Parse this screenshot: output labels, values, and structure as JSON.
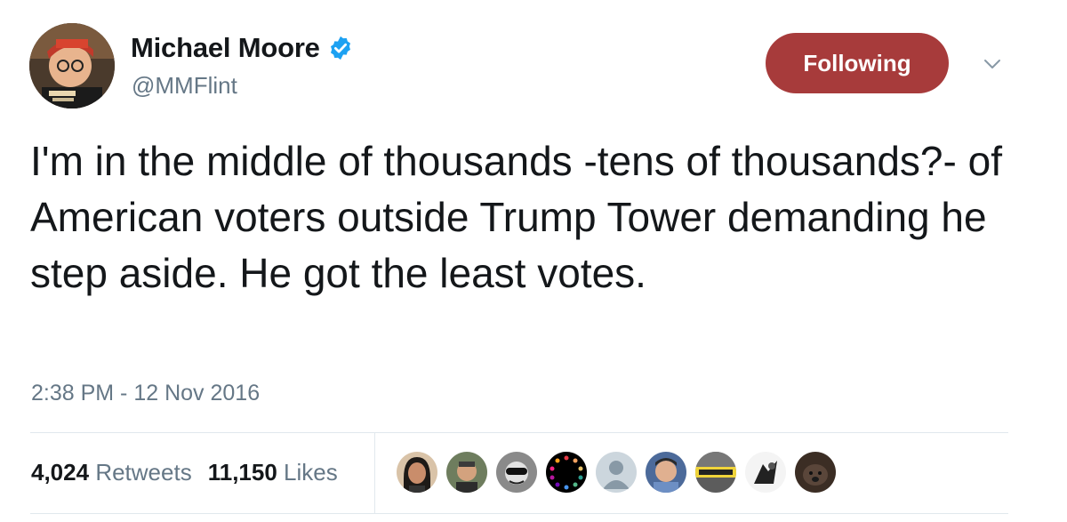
{
  "user": {
    "display_name": "Michael Moore",
    "handle": "@MMFlint"
  },
  "follow_button": {
    "label": "Following",
    "color": "#a73b3b"
  },
  "menu": {
    "icon": "chevron-down-icon"
  },
  "tweet": {
    "text": "I'm in the middle of thousands -tens of thousands?- of American voters outside Trump Tower demanding he step aside. He got the least votes.",
    "timestamp": "2:38 PM - 12 Nov 2016"
  },
  "stats": {
    "retweets_count": "4,024",
    "retweets_label": "Retweets",
    "likes_count": "11,150",
    "likes_label": "Likes"
  },
  "likers": [
    {
      "name": "liker-1-avatar"
    },
    {
      "name": "liker-2-avatar"
    },
    {
      "name": "liker-3-avatar"
    },
    {
      "name": "liker-4-avatar"
    },
    {
      "name": "liker-5-avatar"
    },
    {
      "name": "liker-6-avatar"
    },
    {
      "name": "liker-7-avatar"
    },
    {
      "name": "liker-8-avatar"
    },
    {
      "name": "liker-9-avatar"
    }
  ],
  "colors": {
    "text": "#14171a",
    "secondary": "#657786",
    "verified": "#1da1f2",
    "divider": "#e1e8ed"
  }
}
